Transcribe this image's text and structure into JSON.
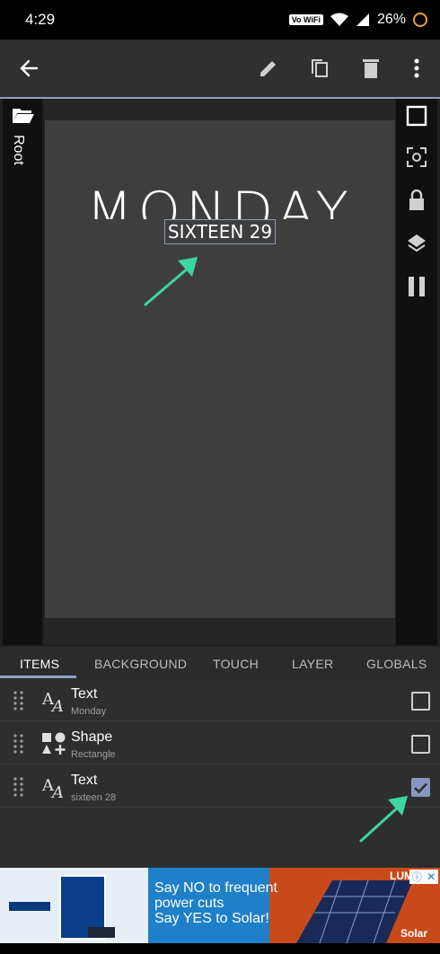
{
  "status_bar": {
    "time": "4:29",
    "vowifi_badge": "Vo WiFi",
    "battery": "26%"
  },
  "app_bar": {
    "back_icon": "arrow-left-icon",
    "edit_icon": "pencil-icon",
    "copy_icon": "copy-icon",
    "delete_icon": "trash-icon",
    "more_icon": "more-vert-icon"
  },
  "editor": {
    "root_label": "Root",
    "canvas_title": "MONDAY",
    "selected_text": "SIXTEEN 29"
  },
  "tabs": [
    {
      "label": "ITEMS",
      "active": true
    },
    {
      "label": "BACKGROUND",
      "active": false
    },
    {
      "label": "TOUCH",
      "active": false
    },
    {
      "label": "LAYER",
      "active": false
    },
    {
      "label": "GLOBALS",
      "active": false
    }
  ],
  "items": [
    {
      "title": "Text",
      "subtitle": "Monday",
      "icon": "text-icon",
      "checked": false
    },
    {
      "title": "Shape",
      "subtitle": "Rectangle",
      "icon": "shape-icon",
      "checked": false
    },
    {
      "title": "Text",
      "subtitle": "sixteen 28",
      "icon": "text-icon",
      "checked": true
    }
  ],
  "ad": {
    "line1": "Say NO to frequent",
    "line2": "power cuts",
    "line3": "Say YES to Solar!",
    "brand": "LUM",
    "tag": "Solar"
  },
  "colors": {
    "accent": "#8fa0c0",
    "arrow": "#3ed6a0"
  }
}
